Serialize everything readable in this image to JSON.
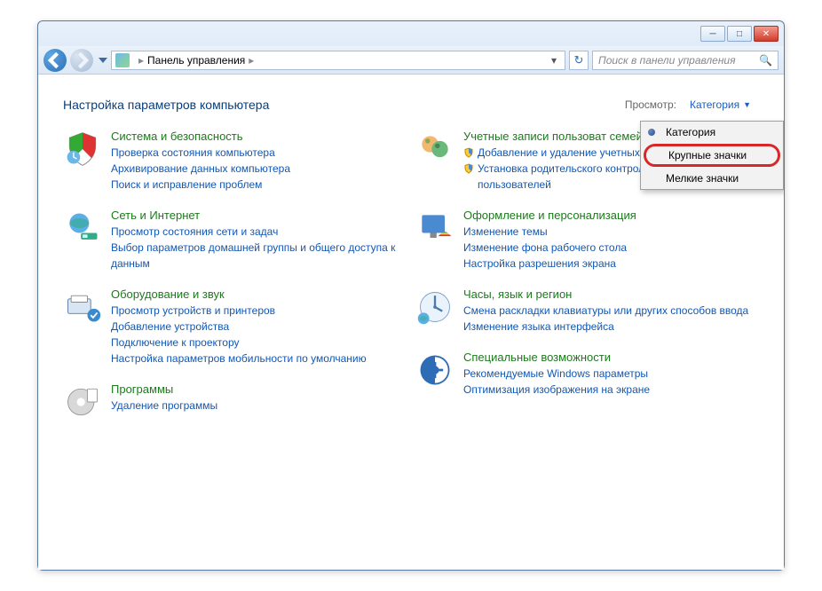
{
  "breadcrumb": {
    "root": "Панель управления"
  },
  "search": {
    "placeholder": "Поиск в панели управления"
  },
  "page": {
    "title": "Настройка параметров компьютера"
  },
  "view": {
    "label": "Просмотр:",
    "current": "Категория",
    "options": {
      "category": "Категория",
      "large": "Крупные значки",
      "small": "Мелкие значки"
    }
  },
  "left": [
    {
      "title": "Система и безопасность",
      "links": [
        {
          "t": "Проверка состояния компьютера"
        },
        {
          "t": "Архивирование данных компьютера"
        },
        {
          "t": "Поиск и исправление проблем"
        }
      ]
    },
    {
      "title": "Сеть и Интернет",
      "links": [
        {
          "t": "Просмотр состояния сети и задач"
        },
        {
          "t": "Выбор параметров домашней группы и общего доступа к данным"
        }
      ]
    },
    {
      "title": "Оборудование и звук",
      "links": [
        {
          "t": "Просмотр устройств и принтеров"
        },
        {
          "t": "Добавление устройства"
        },
        {
          "t": "Подключение к проектору"
        },
        {
          "t": "Настройка параметров мобильности по умолчанию"
        }
      ]
    },
    {
      "title": "Программы",
      "links": [
        {
          "t": "Удаление программы"
        }
      ]
    }
  ],
  "right": [
    {
      "title": "Учетные записи пользоват семейн...",
      "links": [
        {
          "t": "Добавление и удаление учетных пользователей",
          "shield": true
        },
        {
          "t": "Установка родительского контроля для всех пользователей",
          "shield": true
        }
      ]
    },
    {
      "title": "Оформление и персонализация",
      "links": [
        {
          "t": "Изменение темы"
        },
        {
          "t": "Изменение фона рабочего стола"
        },
        {
          "t": "Настройка разрешения экрана"
        }
      ]
    },
    {
      "title": "Часы, язык и регион",
      "links": [
        {
          "t": "Смена раскладки клавиатуры или других способов ввода"
        },
        {
          "t": "Изменение языка интерфейса"
        }
      ]
    },
    {
      "title": "Специальные возможности",
      "links": [
        {
          "t": "Рекомендуемые Windows параметры"
        },
        {
          "t": "Оптимизация изображения на экране"
        }
      ]
    }
  ]
}
